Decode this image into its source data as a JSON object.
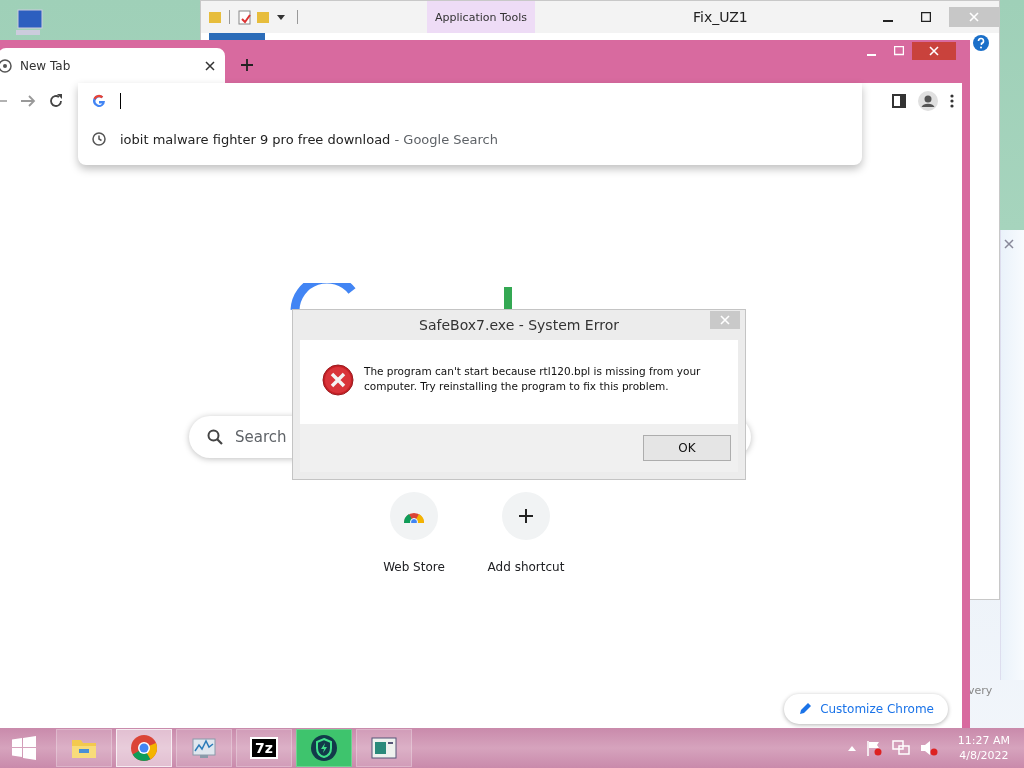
{
  "explorer": {
    "context_tab": "Application Tools",
    "title": "Fix_UZ1"
  },
  "notification": {
    "text": "very"
  },
  "browser": {
    "tabs": [
      {
        "label": "New Tab",
        "selected": true
      }
    ],
    "omnibox": {
      "suggestions": [
        {
          "query": "iobit malware fighter 9 pro free download",
          "source": "- Google Search"
        }
      ]
    },
    "search": {
      "placeholder": "Search"
    },
    "shortcuts": [
      {
        "label": "Web Store",
        "kind": "store"
      },
      {
        "label": "Add shortcut",
        "kind": "add"
      }
    ],
    "customize_button": "Customize Chrome"
  },
  "dialog": {
    "title": "SafeBox7.exe - System Error",
    "message": "The program can't start because rtl120.bpl is missing from your computer. Try reinstalling the program to fix this problem.",
    "buttons": [
      "OK"
    ]
  },
  "taskbar": {
    "apps": [
      {
        "kind": "folder",
        "selected": false
      },
      {
        "kind": "chrome",
        "selected": true
      },
      {
        "kind": "monitor",
        "selected": false
      },
      {
        "kind": "archiver",
        "label": "7z",
        "selected": false
      },
      {
        "kind": "shield",
        "selected": false
      },
      {
        "kind": "window",
        "selected": false
      }
    ],
    "clock": {
      "time": "11:27 AM",
      "date": "4/8/2022"
    }
  }
}
